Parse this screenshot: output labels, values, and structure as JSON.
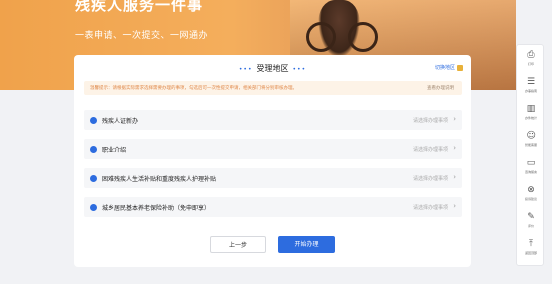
{
  "banner": {
    "title": "残疾人服务一件事",
    "subtitle": "一表申请、一次提交、一网通办"
  },
  "card": {
    "region_title": "受理地区",
    "head_link": "切换地区",
    "notice_text": "温馨提示：请根据实际需求选择需要办理的事项，勾选后可一次性提交申请，相关部门将分别审核办理。",
    "notice_right": "查看办理说明",
    "items": [
      {
        "label": "残疾人证新办",
        "hint": "请选择办理事项"
      },
      {
        "label": "职业介绍",
        "hint": "请选择办理事项"
      },
      {
        "label": "困难残疾人生活补贴和重度残疾人护理补贴",
        "hint": "请选择办理事项"
      },
      {
        "label": "城乡居民基本养老保险补助（免申即享）",
        "hint": "请选择办理事项"
      }
    ],
    "btn_prev": "上一步",
    "btn_start": "开始办理"
  },
  "sidebar": {
    "items": [
      {
        "icon": "print-icon",
        "glyph": "⎙",
        "label": "打印"
      },
      {
        "icon": "document-icon",
        "glyph": "☰",
        "label": "办事指南"
      },
      {
        "icon": "chart-icon",
        "glyph": "▥",
        "label": "办件统计"
      },
      {
        "icon": "robot-icon",
        "glyph": "☺",
        "label": "智能客服"
      },
      {
        "icon": "chat-icon",
        "glyph": "▭",
        "label": "咨询留言"
      },
      {
        "icon": "cancel-icon",
        "glyph": "⊗",
        "label": "投诉建议"
      },
      {
        "icon": "edit-icon",
        "glyph": "✎",
        "label": "评价"
      },
      {
        "icon": "top-icon",
        "glyph": "⤒",
        "label": "返回顶部"
      }
    ]
  }
}
